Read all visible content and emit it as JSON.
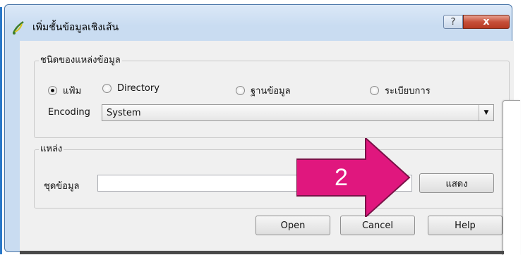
{
  "window": {
    "title": "เพิ่มชั้นข้อมูลเชิงเส้น",
    "help_button_label": "?",
    "close_button_label": "x"
  },
  "source_type_group": {
    "legend": "ชนิดของแหล่งข้อมูล",
    "radios": [
      {
        "label": "แฟ้ม",
        "checked": true
      },
      {
        "label": "Directory",
        "checked": false
      },
      {
        "label": "ฐานข้อมูล",
        "checked": false
      },
      {
        "label": "ระเบียบการ",
        "checked": false
      }
    ],
    "encoding_label": "Encoding",
    "encoding_value": "System"
  },
  "source_group": {
    "legend": "แหล่ง",
    "dataset_label": "ชุดข้อมูล",
    "dataset_value": "",
    "browse_button_label": "แสดง"
  },
  "footer": {
    "open_label": "Open",
    "cancel_label": "Cancel",
    "help_label": "Help"
  },
  "annotation": {
    "text": "2",
    "color": "#e0177e"
  },
  "colors": {
    "frame_border": "#4a76a8",
    "close_button": "#c7503a",
    "accent_bar": "#2a78c8"
  }
}
